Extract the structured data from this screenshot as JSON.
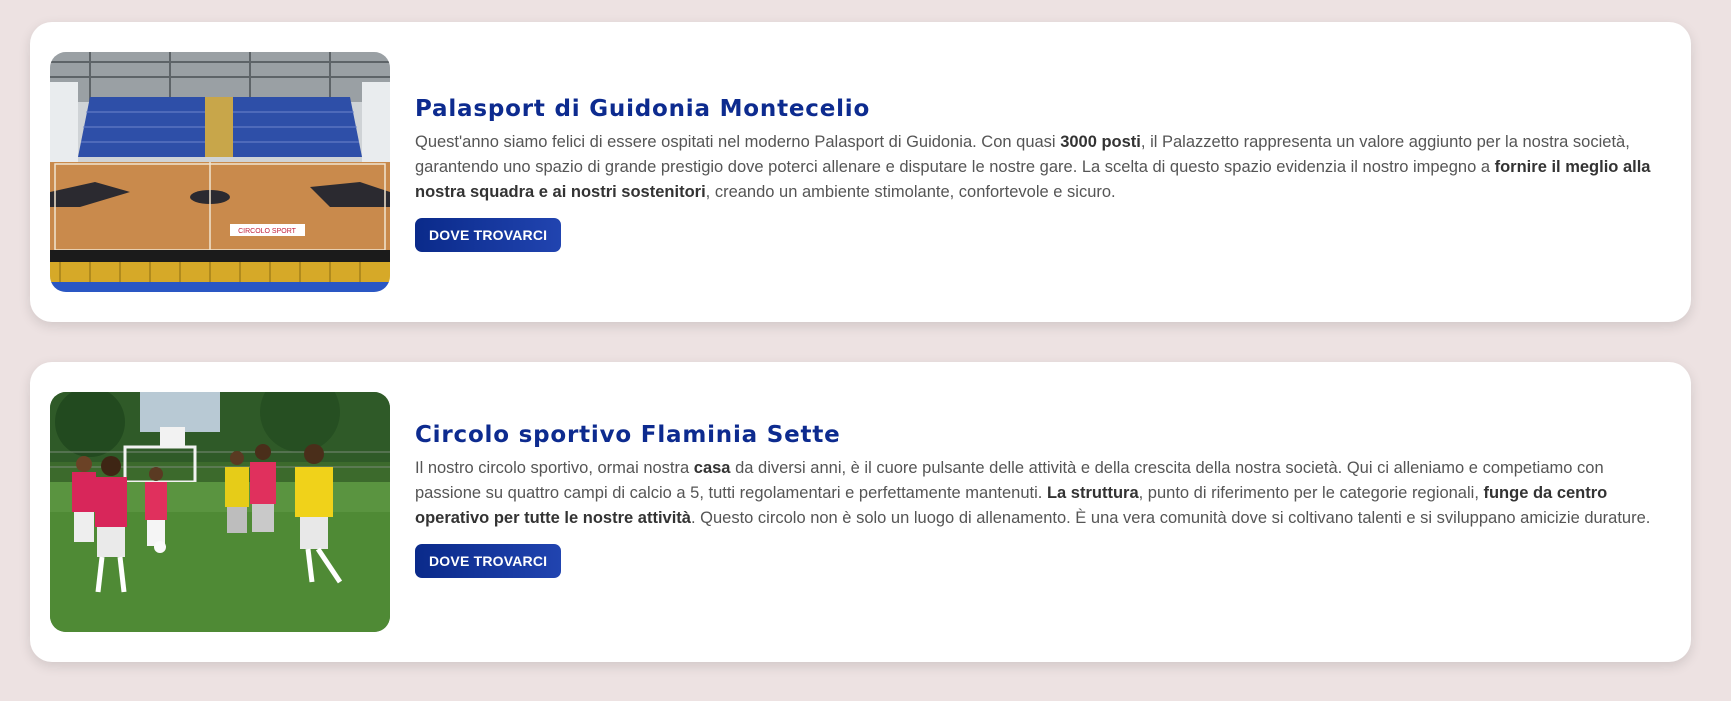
{
  "venues": [
    {
      "title": "Palasport di Guidonia Montecelio",
      "text": [
        "Quest'anno siamo felici di essere ospitati nel moderno Palasport di Guidonia. Con quasi ",
        "3000 posti",
        ", il Palazzetto rappresenta un valore aggiunto per la nostra società, garantendo uno spazio di grande prestigio dove poterci allenare e disputare le nostre gare. La scelta di questo spazio evidenzia il nostro impegno a ",
        "fornire il meglio alla nostra squadra e ai nostri sostenitori",
        ", creando un ambiente stimolante, confortevole e sicuro."
      ],
      "button": "DOVE TROVARCI",
      "photo_sign": "CIRCOLO SPORT"
    },
    {
      "title": "Circolo sportivo Flaminia Sette",
      "text": [
        "Il nostro circolo sportivo, ormai nostra ",
        "casa",
        " da diversi anni, è il cuore pulsante delle attività e della crescita della nostra società. Qui ci alleniamo e competiamo con passione su quattro campi di calcio a 5, tutti regolamentari e perfettamente mantenuti. ",
        "La struttura",
        ", punto di riferimento per le categorie regionali, ",
        "funge da centro operativo per tutte le nostre attività",
        ". Questo circolo non è solo un luogo di allenamento. È una vera comunità dove si coltivano talenti e si sviluppano amicizie durature."
      ],
      "button": "DOVE TROVARCI"
    }
  ],
  "colors": {
    "accent": "#0d2b8f",
    "background": "#ede2e2",
    "card": "#ffffff"
  }
}
